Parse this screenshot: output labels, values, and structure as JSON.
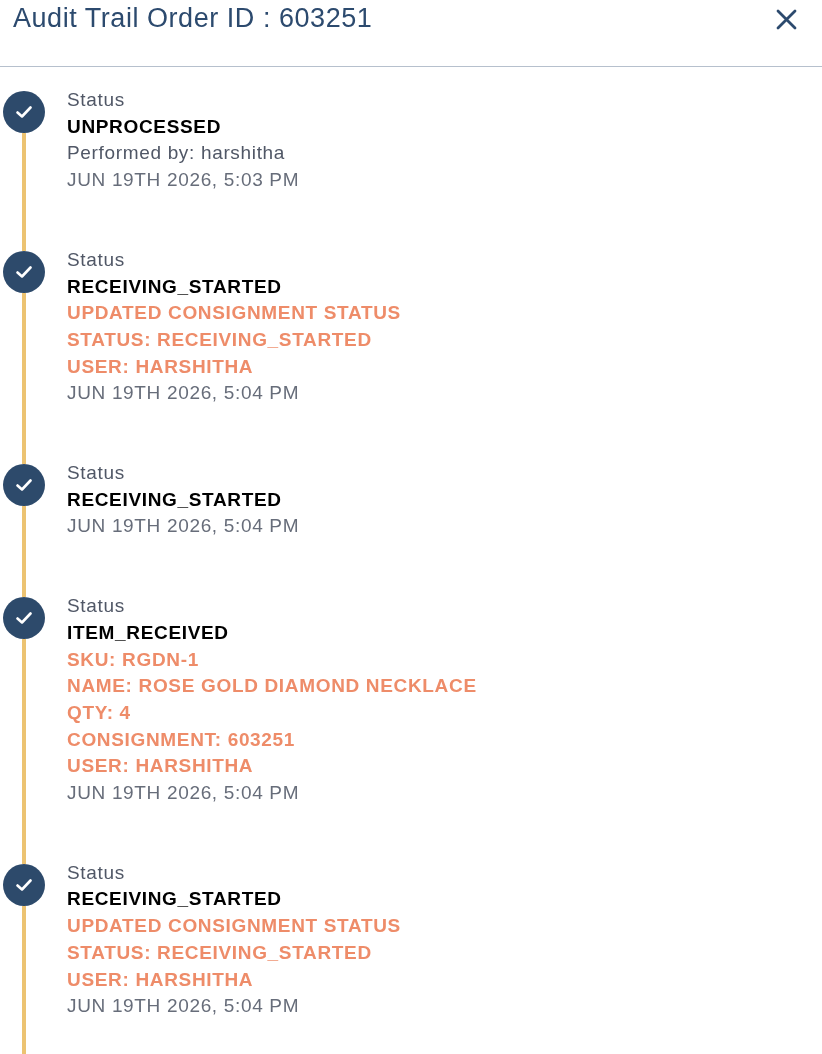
{
  "header": {
    "title": "Audit Trail Order ID : 603251"
  },
  "entries": [
    {
      "completed": true,
      "label": "Status",
      "status": "UNPROCESSED",
      "details": [
        {
          "kind": "performer",
          "text": "Performed by: harshitha"
        }
      ],
      "timestamp": "JUN 19TH 2026, 5:03 PM"
    },
    {
      "completed": true,
      "label": "Status",
      "status": "RECEIVING_STARTED",
      "details": [
        {
          "kind": "change",
          "text": "UPDATED CONSIGNMENT STATUS"
        },
        {
          "kind": "change",
          "text": "STATUS: RECEIVING_STARTED"
        },
        {
          "kind": "change",
          "text": "USER: HARSHITHA"
        }
      ],
      "timestamp": "JUN 19TH 2026, 5:04 PM"
    },
    {
      "completed": true,
      "label": "Status",
      "status": "RECEIVING_STARTED",
      "timestamp": "JUN 19TH 2026, 5:04 PM"
    },
    {
      "completed": true,
      "label": "Status",
      "status": "ITEM_RECEIVED",
      "details": [
        {
          "kind": "change",
          "text": "SKU: RGDN-1"
        },
        {
          "kind": "change",
          "text": "NAME: ROSE GOLD DIAMOND NECKLACE"
        },
        {
          "kind": "change",
          "text": "QTY: 4"
        },
        {
          "kind": "change",
          "text": "CONSIGNMENT: 603251"
        },
        {
          "kind": "change",
          "text": "USER: HARSHITHA"
        }
      ],
      "timestamp": "JUN 19TH 2026, 5:04 PM"
    },
    {
      "completed": true,
      "label": "Status",
      "status": "RECEIVING_STARTED",
      "details": [
        {
          "kind": "change",
          "text": "UPDATED CONSIGNMENT STATUS"
        },
        {
          "kind": "change",
          "text": "STATUS: RECEIVING_STARTED"
        },
        {
          "kind": "change",
          "text": "USER: HARSHITHA"
        }
      ],
      "timestamp": "JUN 19TH 2026, 5:04 PM"
    }
  ]
}
